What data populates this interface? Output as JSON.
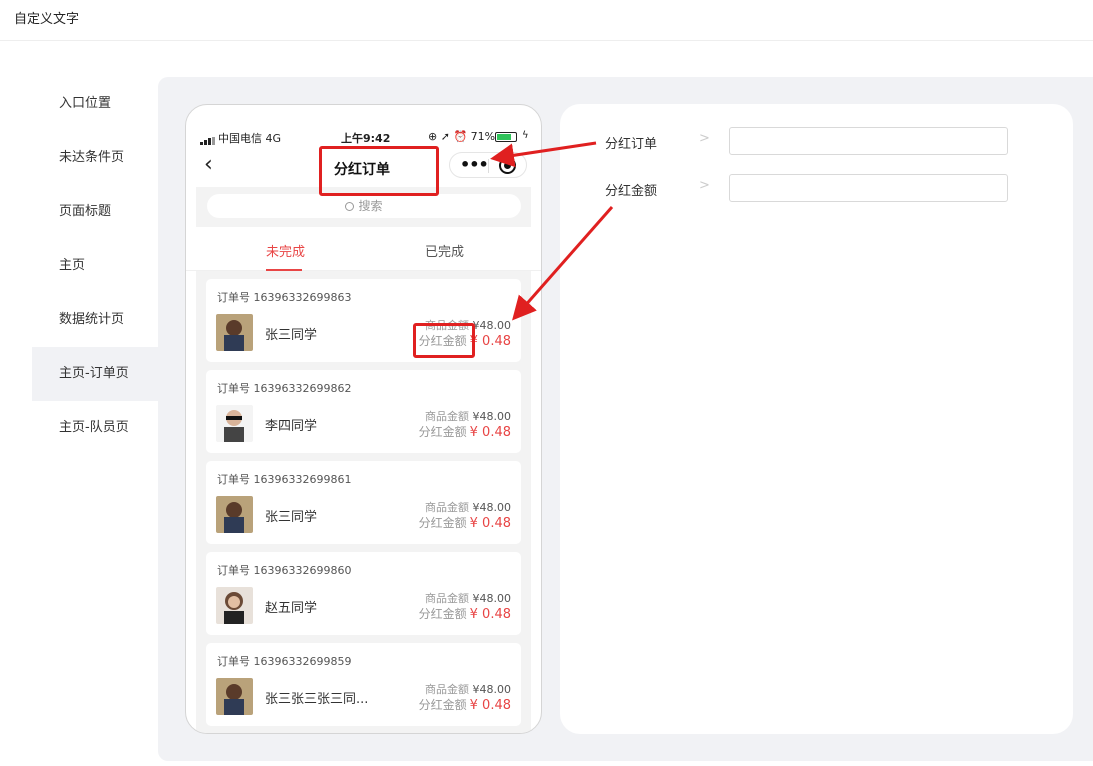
{
  "header": {
    "title": "自定义文字"
  },
  "sidebar": {
    "items": [
      {
        "label": "入口位置"
      },
      {
        "label": "未达条件页"
      },
      {
        "label": "页面标题"
      },
      {
        "label": "主页"
      },
      {
        "label": "数据统计页"
      },
      {
        "label": "主页-订单页",
        "active": true
      },
      {
        "label": "主页-队员页"
      }
    ]
  },
  "phone": {
    "status": {
      "carrier": "中国电信  4G",
      "time": "上午9:42",
      "battery": "71%"
    },
    "nav_title": "分红订单",
    "search_placeholder": "搜索",
    "tabs": [
      {
        "label": "未完成"
      },
      {
        "label": "已完成"
      }
    ],
    "orders": [
      {
        "order_no": "订单号 16396332699863",
        "name": "张三同学",
        "goods_label": "商品金额",
        "goods_amount": "¥48.00",
        "div_label": "分红金额",
        "div_amount": "¥ 0.48"
      },
      {
        "order_no": "订单号 16396332699862",
        "name": "李四同学",
        "goods_label": "商品金额",
        "goods_amount": "¥48.00",
        "div_label": "分红金额",
        "div_amount": "¥ 0.48"
      },
      {
        "order_no": "订单号 16396332699861",
        "name": "张三同学",
        "goods_label": "商品金额",
        "goods_amount": "¥48.00",
        "div_label": "分红金额",
        "div_amount": "¥ 0.48"
      },
      {
        "order_no": "订单号 16396332699860",
        "name": "赵五同学",
        "goods_label": "商品金额",
        "goods_amount": "¥48.00",
        "div_label": "分红金额",
        "div_amount": "¥ 0.48"
      },
      {
        "order_no": "订单号 16396332699859",
        "name": "张三张三张三同...",
        "goods_label": "商品金额",
        "goods_amount": "¥48.00",
        "div_label": "分红金额",
        "div_amount": "¥ 0.48"
      }
    ]
  },
  "form": {
    "fields": [
      {
        "label": "分红订单",
        "value": ""
      },
      {
        "label": "分红金额",
        "value": ""
      }
    ]
  },
  "colors": {
    "accent": "#e84545",
    "annotation": "#e02020",
    "panel_bg": "#f1f2f5"
  }
}
